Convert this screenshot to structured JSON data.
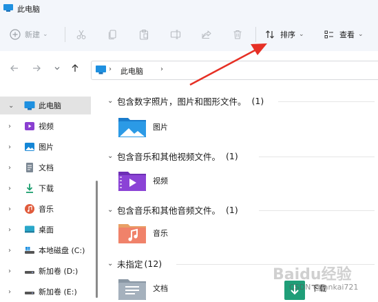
{
  "window": {
    "title": "此电脑"
  },
  "toolbar": {
    "new_label": "新建",
    "sort_label": "排序",
    "view_label": "查看",
    "disabled_icons": [
      "cut-icon",
      "copy-icon",
      "paste-icon",
      "rename-icon",
      "share-icon",
      "delete-icon"
    ]
  },
  "address": {
    "crumb": "此电脑"
  },
  "sidebar": {
    "items": [
      {
        "label": "此电脑",
        "icon": "pc-icon",
        "expanded": true
      },
      {
        "label": "视频",
        "icon": "video-folder-icon"
      },
      {
        "label": "图片",
        "icon": "picture-folder-icon"
      },
      {
        "label": "文档",
        "icon": "document-folder-icon"
      },
      {
        "label": "下载",
        "icon": "download-folder-icon"
      },
      {
        "label": "音乐",
        "icon": "music-folder-icon"
      },
      {
        "label": "桌面",
        "icon": "desktop-folder-icon"
      },
      {
        "label": "本地磁盘 (C:)",
        "icon": "drive-icon"
      },
      {
        "label": "新加卷 (D:)",
        "icon": "drive-icon"
      },
      {
        "label": "新加卷 (E:)",
        "icon": "drive-icon"
      }
    ]
  },
  "groups": [
    {
      "title": "包含数字照片，图片和图形文件。",
      "count": "(1)",
      "items": [
        "图片"
      ]
    },
    {
      "title": "包含音乐和其他视频文件。",
      "count": "(1)",
      "items": [
        "视频"
      ]
    },
    {
      "title": "包含音乐和其他音频文件。",
      "count": "(1)",
      "items": [
        "音乐"
      ]
    },
    {
      "title": "未指定",
      "count": "(12)",
      "items": [
        "文档",
        "下载"
      ]
    }
  ],
  "watermark": {
    "baidu": "Baidu经验",
    "csdn": "CSDN @fankai721"
  },
  "colors": {
    "accent": "#0078d4",
    "arrow": "#e63025",
    "selected": "#e3e3e3"
  }
}
